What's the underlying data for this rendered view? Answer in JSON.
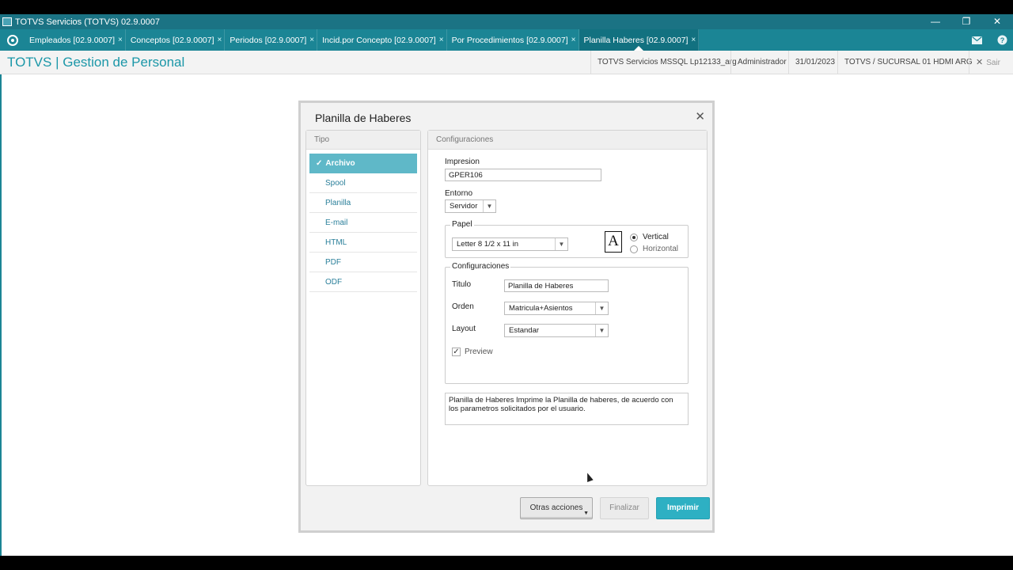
{
  "window": {
    "title": "TOTVS Servicios (TOTVS) 02.9.0007",
    "controls": {
      "minimize": "—",
      "restore": "❐",
      "close": "✕"
    }
  },
  "tabs": [
    {
      "label": "Empleados [02.9.0007]"
    },
    {
      "label": "Conceptos [02.9.0007]"
    },
    {
      "label": "Periodos [02.9.0007]"
    },
    {
      "label": "Incid.por Concepto [02.9.0007]"
    },
    {
      "label": "Por Procedimientos [02.9.0007]"
    },
    {
      "label": "Planilla Haberes [02.9.0007]",
      "active": true
    }
  ],
  "tab_close_glyph": "×",
  "header": {
    "brand": "TOTVS | Gestion de Personal",
    "server": "TOTVS Servicios MSSQL Lp12133_arg",
    "user": "Administrador",
    "date": "31/01/2023",
    "branch": "TOTVS / SUCURSAL 01 HDMI ARG",
    "exit_label": "Sair",
    "exit_glyph": "✕"
  },
  "icons": {
    "mail": "mail-icon",
    "help": "help-icon",
    "home": "home-icon"
  },
  "modal": {
    "title": "Planilla de Haberes",
    "close_glyph": "✕",
    "tipo": {
      "header": "Tipo",
      "check_glyph": "✓",
      "items": [
        {
          "label": "Archivo",
          "selected": true
        },
        {
          "label": "Spool"
        },
        {
          "label": "Planilla"
        },
        {
          "label": "E-mail"
        },
        {
          "label": "HTML"
        },
        {
          "label": "PDF"
        },
        {
          "label": "ODF"
        }
      ]
    },
    "config": {
      "header": "Configuraciones",
      "impresion_label": "Impresion",
      "impresion_value": "GPER106",
      "entorno_label": "Entorno",
      "entorno_value": "Servidor",
      "papel": {
        "title": "Papel",
        "size": "Letter 8 1/2 x 11 in",
        "icon_letter": "A",
        "orientation_vertical": "Vertical",
        "orientation_horizontal": "Horizontal",
        "selected_orientation": "Vertical"
      },
      "configuraciones": {
        "title": "Configuraciones",
        "titulo_label": "Titulo",
        "titulo_value": "Planilla de Haberes",
        "orden_label": "Orden",
        "orden_value": "Matricula+Asientos",
        "layout_label": "Layout",
        "layout_value": "Estandar",
        "preview_label": "Preview",
        "preview_checked": true,
        "check_glyph": "✓"
      },
      "description": "Planilla de Haberes Imprime la Planilla de haberes, de acuerdo con los parametros solicitados por el usuario."
    },
    "buttons": {
      "otras": "Otras acciones",
      "finalizar": "Finalizar",
      "imprimir": "Imprimir"
    }
  },
  "colors": {
    "teal_dark": "#1b7384",
    "teal": "#1b8595",
    "brand": "#1b97a8",
    "primary_button": "#2eb0c3"
  }
}
